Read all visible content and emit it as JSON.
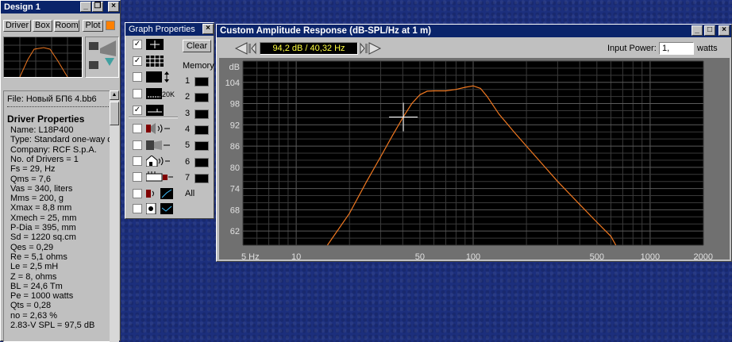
{
  "design": {
    "title": "Design 1",
    "tabs": [
      "Driver",
      "Box",
      "Room",
      "Plot"
    ],
    "file_line": "File: Новый БП6 4.bb6",
    "properties_header": "Driver Properties",
    "properties": [
      "Name: L18P400",
      "Type: Standard one-way d",
      "Company: RCF S.p.A.",
      "No. of Drivers = 1",
      "Fs = 29, Hz",
      "Qms = 7,6",
      "Vas = 340, liters",
      "Mms = 200, g",
      "Xmax = 8,8 mm",
      "Xmech = 25, mm",
      "P-Dia = 395, mm",
      "Sd = 1220 sq.cm",
      "Qes = 0,29",
      "Re = 5,1 ohms",
      "Le = 2,5 mH",
      "Z = 8, ohms",
      "BL = 24,6 Tm",
      "Pe = 1000 watts",
      "Qts = 0,28",
      "no = 2,63 %",
      "2.83-V SPL = 97,5 dB"
    ]
  },
  "graph_properties": {
    "title": "Graph Properties",
    "clear_label": "Clear",
    "memory_label": "Memory",
    "memory_slots": [
      "1",
      "2",
      "3",
      "4",
      "5",
      "6",
      "7",
      "All"
    ],
    "icon_20k": "20K",
    "rows": [
      {
        "icon": "crosshair-icon",
        "checked": true
      },
      {
        "icon": "grid-icon",
        "checked": true
      },
      {
        "icon": "vertical-scale-icon",
        "checked": false
      },
      {
        "icon": "frequency-range-icon",
        "checked": false
      },
      {
        "icon": "phase-icon",
        "checked": true
      },
      {
        "icon": "speaker-sound-icon",
        "checked": false
      },
      {
        "icon": "speaker-box-icon",
        "checked": false
      },
      {
        "icon": "room-speaker-icon",
        "checked": false
      },
      {
        "icon": "amplifier-icon",
        "checked": false
      },
      {
        "icon": "speaker-graph-icon",
        "checked": false
      },
      {
        "icon": "driver-graph-icon",
        "checked": false
      }
    ]
  },
  "amplitude": {
    "title": "Custom Amplitude Response (dB-SPL/Hz at 1 m)",
    "readout": "94,2 dB / 40,32 Hz",
    "input_power_label": "Input Power:",
    "input_power_value": "1,",
    "input_power_unit": "watts"
  },
  "chart_data": {
    "type": "line",
    "title": "Custom Amplitude Response (dB-SPL/Hz at 1 m)",
    "ylabel": "dB",
    "xlabel": "",
    "x_scale": "log",
    "xlim": [
      5,
      2000
    ],
    "ylim": [
      58,
      110
    ],
    "y_ticks": [
      62,
      68,
      74,
      80,
      86,
      92,
      98,
      104
    ],
    "x_tick_labels": [
      {
        "value": 5,
        "label": "5 Hz"
      },
      {
        "value": 10,
        "label": "10"
      },
      {
        "value": 50,
        "label": "50"
      },
      {
        "value": 100,
        "label": "100"
      },
      {
        "value": 500,
        "label": "500"
      },
      {
        "value": 1000,
        "label": "1000"
      },
      {
        "value": 2000,
        "label": "2000"
      }
    ],
    "grid": true,
    "line_color": "#f07820",
    "cursor": {
      "x": 40.32,
      "y": 94.2
    },
    "series": [
      {
        "x": [
          15,
          20,
          25,
          30,
          35,
          40,
          45,
          50,
          55,
          60,
          70,
          80,
          90,
          100,
          110,
          120,
          140,
          170,
          200,
          250,
          300,
          400,
          500,
          600,
          640
        ],
        "y": [
          58,
          67,
          76,
          83,
          89,
          94,
          98,
          100.5,
          101.5,
          101.6,
          101.6,
          102,
          102.6,
          103,
          102.3,
          100,
          95,
          90,
          86,
          80.5,
          76,
          69.5,
          64.5,
          60.5,
          58
        ]
      }
    ]
  }
}
